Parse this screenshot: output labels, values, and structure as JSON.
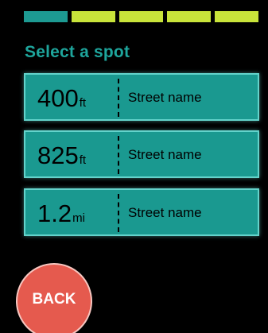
{
  "progress": {
    "total_steps": 5,
    "current_step": 1,
    "active_color": "#1d9a92",
    "inactive_color": "#c8e33a"
  },
  "title": "Select a spot",
  "spots": [
    {
      "distance": "400",
      "unit": "ft",
      "street": "Street name"
    },
    {
      "distance": "825",
      "unit": "ft",
      "street": "Street name"
    },
    {
      "distance": "1.2",
      "unit": "mi",
      "street": "Street name"
    }
  ],
  "back_button": {
    "label": "BACK",
    "color": "#e55a4e"
  },
  "colors": {
    "background": "#000000",
    "accent": "#1ea59c",
    "card": "#1a9990",
    "card_border": "#63d3cb"
  }
}
